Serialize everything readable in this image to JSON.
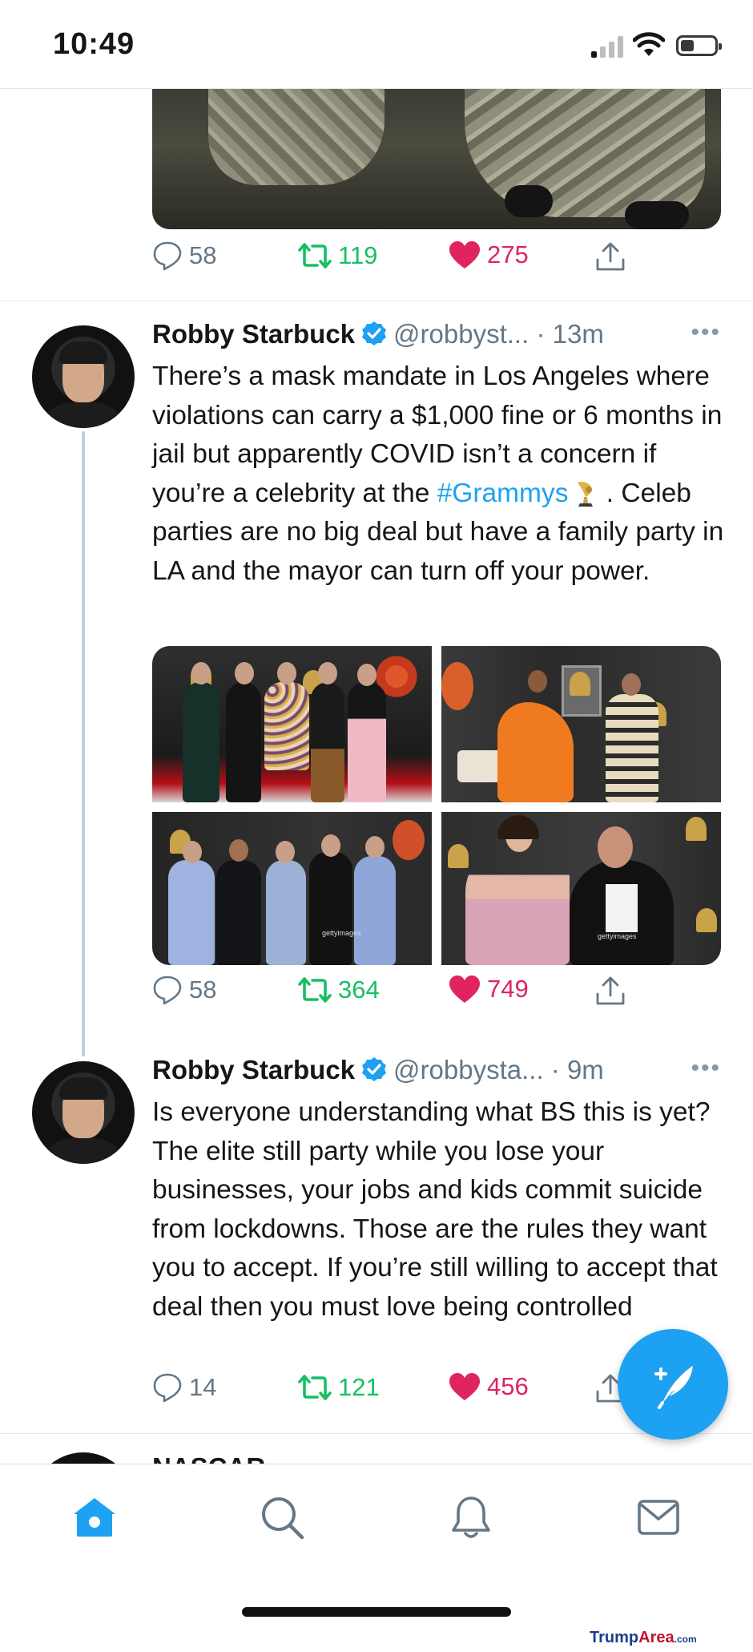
{
  "status_bar": {
    "time": "10:49"
  },
  "tweet0": {
    "reply_count": "58",
    "retweet_count": "119",
    "like_count": "275"
  },
  "tweet1": {
    "name": "Robby Starbuck",
    "handle": "@robbyst...",
    "time": "· 13m",
    "more": "•••",
    "text_before": "There’s a mask mandate in Los Angeles where violations can carry a $1,000 fine or 6 months in jail but apparently COVID isn’t a concern if you’re a celebrity at the ",
    "hashtag": "#Grammys",
    "text_after": " . Celeb parties are no big deal but have a family party in LA and the mayor can turn off your power.",
    "image_watermark": "gettyimages",
    "reply_count": "58",
    "retweet_count": "364",
    "like_count": "749"
  },
  "tweet2": {
    "name": "Robby Starbuck",
    "handle": "@robbysta...",
    "time": "· 9m",
    "more": "•••",
    "text": "Is everyone understanding what BS this is yet? The elite still party while you lose your businesses, your jobs and kids commit suicide from lockdowns. Those are the rules they want you to accept. If you’re still willing to accept that deal then you must love being controlled",
    "reply_count": "14",
    "retweet_count": "121",
    "like_count": "456"
  },
  "next_tweet": {
    "name": "NASCAR"
  },
  "tabs": [
    {
      "icon": "home-icon",
      "active": true
    },
    {
      "icon": "search-icon",
      "active": false
    },
    {
      "icon": "notifications-icon",
      "active": false
    },
    {
      "icon": "messages-icon",
      "active": false
    }
  ],
  "colors": {
    "accent": "#1da1f2",
    "retweet": "#17bf63",
    "like": "#e0245e",
    "muted": "#657786"
  },
  "watermark": {
    "part1": "Trump",
    "part2": "Area",
    "part3": ".com"
  }
}
